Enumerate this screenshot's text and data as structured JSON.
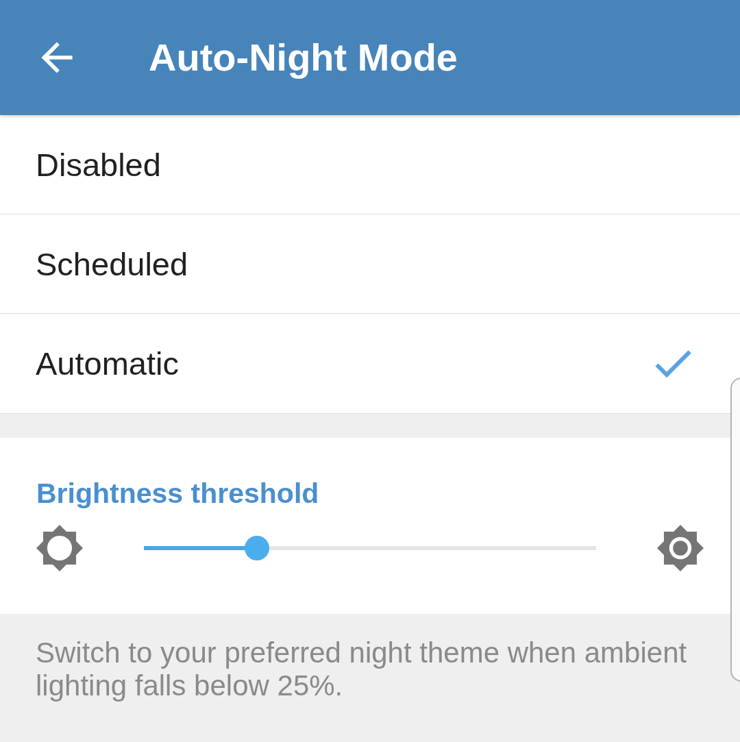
{
  "app_bar": {
    "title": "Auto-Night Mode"
  },
  "options": [
    {
      "label": "Disabled",
      "selected": false
    },
    {
      "label": "Scheduled",
      "selected": false
    },
    {
      "label": "Automatic",
      "selected": true
    }
  ],
  "threshold": {
    "title": "Brightness threshold",
    "level": 0.25
  },
  "hint": "Switch to your preferred night theme when ambient lighting falls below 25%."
}
